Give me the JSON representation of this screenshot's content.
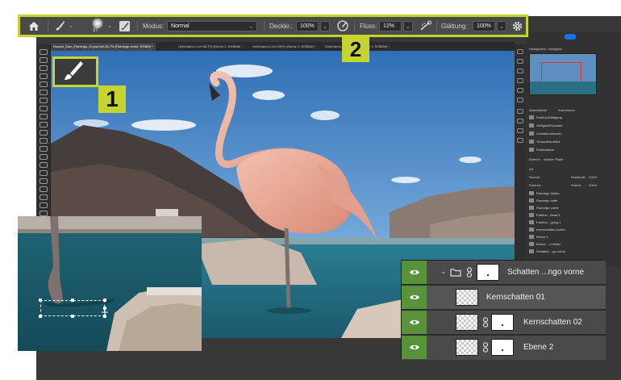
{
  "options_bar": {
    "brush_size": "37",
    "mode_label": "Modus:",
    "mode_value": "Normal",
    "opacity_label": "Deckkr.:",
    "opacity_value": "100%",
    "flow_label": "Fluss:",
    "flow_value": "12%",
    "smoothing_label": "Glättung:",
    "smoothing_value": "100%"
  },
  "callouts": {
    "one": "1",
    "two": "2"
  },
  "document_tabs": [
    "Hoover_Dam_Flamingo_01.psd bei 28,7% (Flamingo vorne, RGB/8) *",
    "Unbenannt-1 bei 66,7% (Ebene 1, RGB/8#) *",
    "Unbenannt-2 bei 100% (Ebene 1, RGB/8#) *",
    "Unbenannt-3 bei 66,7% (Ebene 1, RGB/8#) *"
  ],
  "right_panels": {
    "top_tabs": [
      "Histogramm",
      "Navigator"
    ],
    "history_tabs": [
      "Aktionsleiste",
      "Korrekturen"
    ],
    "history_items": [
      "Farbton/Sättigung",
      "Helligkeit/Kontrast",
      "Gradationskurven",
      "Tonwertkorrektur",
      "Farbbalance"
    ],
    "layer_tabs": [
      "Ebenen",
      "Kanäle",
      "Pfade"
    ],
    "kind_label": "Art",
    "blend": "Normal",
    "opacity_label": "Deckkraft:",
    "opacity": "100%",
    "lock_label": "Fixieren:",
    "fill_label": "Fläche:",
    "fill": "100%",
    "mini_layers": [
      "Flamingo hinten",
      "Flamingo mitte",
      "Flamingo vorne",
      "Farbton...rbrad 1",
      "Farbton ...gung 1",
      "Kernschatten vorhin",
      "Ebene 1",
      "Ebene ...o hinten",
      "Schatten ...go vorne"
    ]
  },
  "layers_panel": {
    "group_name": "Schatten ...ngo vorne",
    "rows": [
      "Kernschatten 01",
      "Kernschatten 02",
      "Ebene 2"
    ]
  },
  "colors": {
    "accent": "#c6d431",
    "visibility_green": "#58923a",
    "ui_dark": "#383838"
  }
}
